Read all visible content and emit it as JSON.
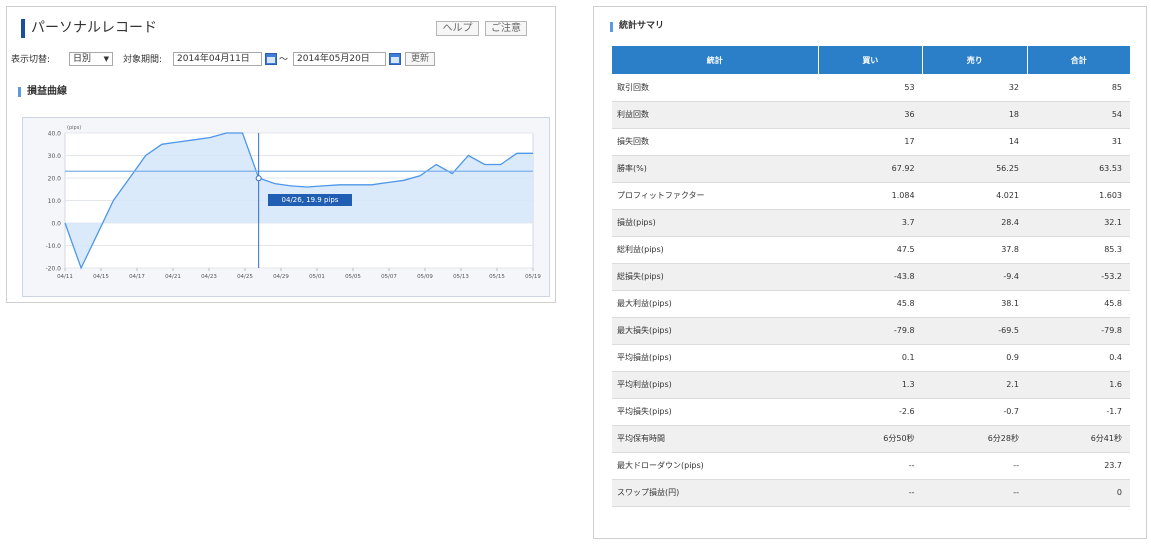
{
  "left_panel": {
    "title": "パーソナルレコード",
    "help_label": "ヘルプ",
    "caution_label": "ご注意",
    "view_label": "表示切替:",
    "view_select": "日別",
    "period_label": "対象期間:",
    "date_from": "2014年04月11日",
    "tilde": "～",
    "date_to": "2014年05月20日",
    "update_label": "更新",
    "chart_section_title": "損益曲線",
    "tooltip": "04/26, 19.9 pips"
  },
  "chart_data": {
    "type": "area",
    "unit_label": "(pips)",
    "x_tick_labels": [
      "04/11",
      "04/15",
      "04/17",
      "04/21",
      "04/23",
      "04/25",
      "04/29",
      "05/01",
      "05/05",
      "05/07",
      "05/09",
      "05/13",
      "05/15",
      "05/19"
    ],
    "y_tick_labels": [
      "40.0",
      "30.0",
      "20.0",
      "10.0",
      "0.0",
      "-10.0",
      "-20.0"
    ],
    "ylim": [
      -20,
      40
    ],
    "grid": true,
    "series": [
      {
        "values": [
          0,
          -20,
          -5,
          10,
          20,
          30,
          35,
          36,
          37,
          38,
          40,
          40,
          20,
          17.5,
          16.5,
          16,
          16.5,
          17,
          17,
          17,
          18,
          19,
          21,
          26,
          22,
          30,
          26,
          26,
          31,
          31
        ]
      }
    ],
    "reference_value": 23,
    "highlight": {
      "index": 12,
      "value": 19.9
    },
    "colors": {
      "line": "#4d97ea",
      "fill": "#d3e6fa",
      "ref": "#7fb1ea",
      "marker": "#2f6fc5"
    }
  },
  "right_panel": {
    "title": "統計サマリ",
    "columns": [
      "統計",
      "買い",
      "売り",
      "合計"
    ],
    "rows": [
      [
        "取引回数",
        "53",
        "32",
        "85"
      ],
      [
        "利益回数",
        "36",
        "18",
        "54"
      ],
      [
        "損失回数",
        "17",
        "14",
        "31"
      ],
      [
        "勝率(%)",
        "67.92",
        "56.25",
        "63.53"
      ],
      [
        "プロフィットファクター",
        "1.084",
        "4.021",
        "1.603"
      ],
      [
        "損益(pips)",
        "3.7",
        "28.4",
        "32.1"
      ],
      [
        "総利益(pips)",
        "47.5",
        "37.8",
        "85.3"
      ],
      [
        "総損失(pips)",
        "-43.8",
        "-9.4",
        "-53.2"
      ],
      [
        "最大利益(pips)",
        "45.8",
        "38.1",
        "45.8"
      ],
      [
        "最大損失(pips)",
        "-79.8",
        "-69.5",
        "-79.8"
      ],
      [
        "平均損益(pips)",
        "0.1",
        "0.9",
        "0.4"
      ],
      [
        "平均利益(pips)",
        "1.3",
        "2.1",
        "1.6"
      ],
      [
        "平均損失(pips)",
        "-2.6",
        "-0.7",
        "-1.7"
      ],
      [
        "平均保有時間",
        "6分50秒",
        "6分28秒",
        "6分41秒"
      ],
      [
        "最大ドローダウン(pips)",
        "--",
        "--",
        "23.7"
      ],
      [
        "スワップ損益(円)",
        "--",
        "--",
        "0"
      ]
    ]
  },
  "colors": {
    "accent": "#1a4fa0",
    "header_bg": "#2b7fc9",
    "section_bar": "#5a9be0"
  }
}
